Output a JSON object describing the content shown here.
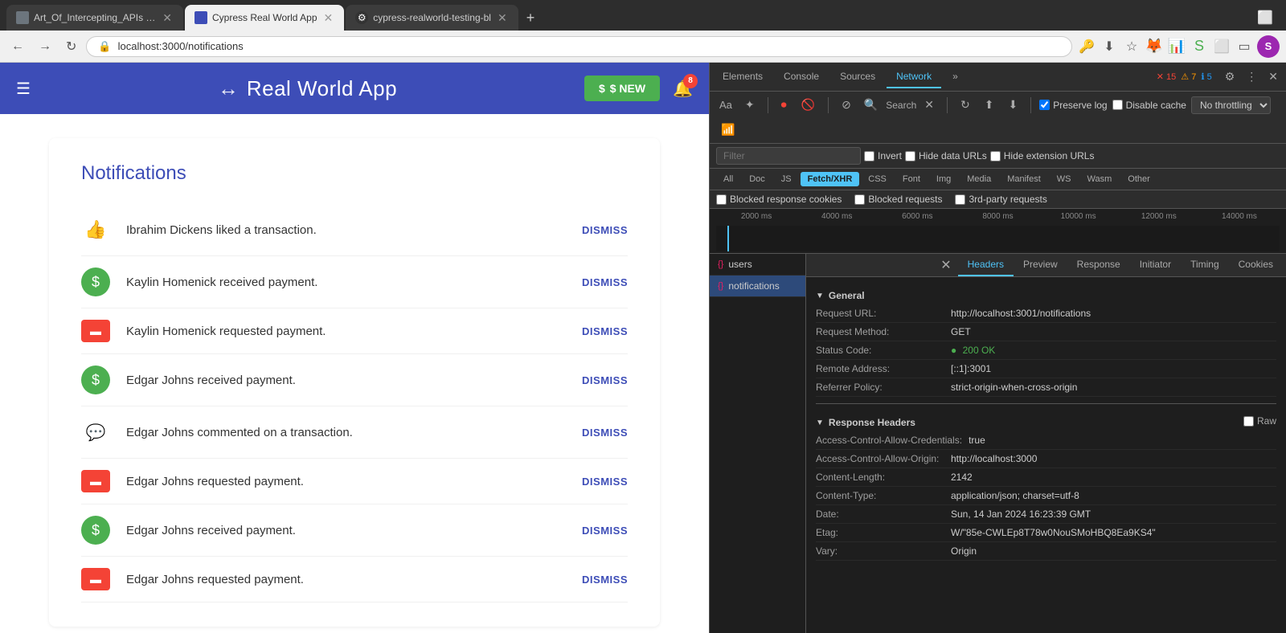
{
  "browser": {
    "tabs": [
      {
        "id": "tab1",
        "title": "Art_Of_Intercepting_APIs - C",
        "active": false,
        "icon_color": "#6c757d"
      },
      {
        "id": "tab2",
        "title": "Cypress Real World App",
        "active": true,
        "icon_color": "#3d4db7"
      },
      {
        "id": "tab3",
        "title": "cypress-realworld-testing-bl",
        "active": false,
        "icon_color": "#333"
      }
    ],
    "new_tab_label": "+",
    "address": "localhost:3000/notifications",
    "profile_initial": "S"
  },
  "app": {
    "title": "Real World App",
    "header_bg": "#3d4db7",
    "new_btn_label": "$ NEW",
    "bell_count": "8",
    "notifications_heading": "Notifications",
    "notifications": [
      {
        "id": 1,
        "icon_type": "thumb",
        "text": "Ibrahim Dickens liked a transaction.",
        "dismiss": "DISMISS"
      },
      {
        "id": 2,
        "icon_type": "dollar",
        "text": "Kaylin Homenick received payment.",
        "dismiss": "DISMISS"
      },
      {
        "id": 3,
        "icon_type": "card",
        "text": "Kaylin Homenick requested payment.",
        "dismiss": "DISMISS"
      },
      {
        "id": 4,
        "icon_type": "dollar",
        "text": "Edgar Johns received payment.",
        "dismiss": "DISMISS"
      },
      {
        "id": 5,
        "icon_type": "comment",
        "text": "Edgar Johns commented on a transaction.",
        "dismiss": "DISMISS"
      },
      {
        "id": 6,
        "icon_type": "card",
        "text": "Edgar Johns requested payment.",
        "dismiss": "DISMISS"
      },
      {
        "id": 7,
        "icon_type": "dollar",
        "text": "Edgar Johns received payment.",
        "dismiss": "DISMISS"
      },
      {
        "id": 8,
        "icon_type": "card",
        "text": "Edgar Johns requested payment.",
        "dismiss": "DISMISS"
      }
    ]
  },
  "devtools": {
    "tabs": [
      "Elements",
      "Console",
      "Sources",
      "Network",
      "»"
    ],
    "active_tab": "Network",
    "toolbar": {
      "search_label": "Search",
      "preserve_log_label": "Preserve log",
      "disable_cache_label": "Disable cache",
      "throttle_label": "No throttling",
      "preserve_log_checked": true,
      "disable_cache_checked": false
    },
    "filter": {
      "placeholder": "Filter",
      "invert_label": "Invert",
      "hide_data_urls_label": "Hide data URLs",
      "hide_ext_urls_label": "Hide extension URLs"
    },
    "filter_types": [
      {
        "label": "All",
        "active": false
      },
      {
        "label": "Doc",
        "active": false
      },
      {
        "label": "JS",
        "active": false
      },
      {
        "label": "Fetch/XHR",
        "active": true
      },
      {
        "label": "CSS",
        "active": false
      },
      {
        "label": "Font",
        "active": false
      },
      {
        "label": "Img",
        "active": false
      },
      {
        "label": "Media",
        "active": false
      },
      {
        "label": "Manifest",
        "active": false
      },
      {
        "label": "WS",
        "active": false
      },
      {
        "label": "Wasm",
        "active": false
      },
      {
        "label": "Other",
        "active": false
      }
    ],
    "blocked": {
      "blocked_cookies_label": "Blocked response cookies",
      "blocked_requests_label": "Blocked requests",
      "third_party_label": "3rd-party requests"
    },
    "timeline": {
      "labels": [
        "2000 ms",
        "4000 ms",
        "6000 ms",
        "8000 ms",
        "10000 ms",
        "12000 ms",
        "14000 ms"
      ]
    },
    "requests": [
      {
        "name": "users",
        "selected": false
      },
      {
        "name": "notifications",
        "selected": true
      }
    ],
    "detail": {
      "tabs": [
        "Headers",
        "Preview",
        "Response",
        "Initiator",
        "Timing",
        "Cookies"
      ],
      "active_tab": "Headers",
      "general": {
        "section_label": "General",
        "request_url_label": "Request URL:",
        "request_url_value": "http://localhost:3001/notifications",
        "request_method_label": "Request Method:",
        "request_method_value": "GET",
        "status_code_label": "Status Code:",
        "status_code_value": "200 OK",
        "remote_address_label": "Remote Address:",
        "remote_address_value": "[::1]:3001",
        "referrer_policy_label": "Referrer Policy:",
        "referrer_policy_value": "strict-origin-when-cross-origin"
      },
      "response_headers": {
        "section_label": "Response Headers",
        "raw_label": "Raw",
        "rows": [
          {
            "key": "Access-Control-Allow-Credentials:",
            "val": "true"
          },
          {
            "key": "Access-Control-Allow-Origin:",
            "val": "http://localhost:3000"
          },
          {
            "key": "Content-Length:",
            "val": "2142"
          },
          {
            "key": "Content-Type:",
            "val": "application/json; charset=utf-8"
          },
          {
            "key": "Date:",
            "val": "Sun, 14 Jan 2024 16:23:39 GMT"
          },
          {
            "key": "Etag:",
            "val": "W/\"85e-CWLEp8T78w0NouSMoHBQ8Ea9KS4\""
          },
          {
            "key": "Vary:",
            "val": "Origin"
          }
        ]
      }
    }
  },
  "icons": {
    "back": "←",
    "forward": "→",
    "reload": "↻",
    "lock": "🔒",
    "star": "☆",
    "download": "⬇",
    "menu": "⋮",
    "hamburger": "☰",
    "dollar": "$",
    "bell": "🔔",
    "thumb": "👍",
    "card": "▬",
    "comment": "💬",
    "close": "✕",
    "record": "⏺",
    "clear": "🚫",
    "filter": "⊘",
    "search": "🔍",
    "settings": "⚙",
    "more_vert": "⋮",
    "toggle_down": "▶",
    "toggle_open": "▼",
    "error_count": "15",
    "warn_count": "7",
    "info_count": "5"
  }
}
